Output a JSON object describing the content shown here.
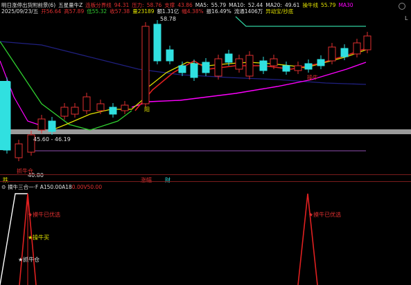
{
  "main_header": {
    "row1": [
      {
        "text": "明日涨停出货附前景(6)",
        "color": "#e0e0e0"
      },
      {
        "text": "五星量牛Z",
        "color": "#e0e0e0"
      },
      {
        "text": "连板分界线",
        "color": "#e03030"
      },
      {
        "text": "94.31",
        "color": "#e03030"
      },
      {
        "text": "压力:",
        "color": "#e03030"
      },
      {
        "text": "58.76",
        "color": "#e03030"
      },
      {
        "text": "支撑",
        "color": "#e03030"
      },
      {
        "text": "43.86",
        "color": "#e03030"
      },
      {
        "text": "MA5:",
        "color": "#e0e0e0"
      },
      {
        "text": "55.79",
        "color": "#e0e0e0"
      },
      {
        "text": "MA10:",
        "color": "#e0e0e0"
      },
      {
        "text": "52.44",
        "color": "#e0e0e0"
      },
      {
        "text": "MA20:",
        "color": "#e0e0e0"
      },
      {
        "text": "49.61",
        "color": "#e0e0e0"
      },
      {
        "text": "操牛线",
        "color": "#e0e000"
      },
      {
        "text": "55.79",
        "color": "#e0e000"
      },
      {
        "text": "MA30",
        "color": "#ff00ff"
      }
    ],
    "row2": [
      {
        "text": "2025/09/23/五",
        "color": "#e0e0e0"
      },
      {
        "text": "开56.64",
        "color": "#e03030"
      },
      {
        "text": "高57.89",
        "color": "#e03030"
      },
      {
        "text": "低55.32",
        "color": "#33cc33"
      },
      {
        "text": "收57.38",
        "color": "#e03030"
      },
      {
        "text": "量23189",
        "color": "#e0e000"
      },
      {
        "text": "额1.31亿",
        "color": "#e0e0e0"
      },
      {
        "text": "幅4.38%",
        "color": "#e03030"
      },
      {
        "text": "振16.49%",
        "color": "#e0e0e0"
      },
      {
        "text": "流通1406万",
        "color": "#e0e0e0"
      },
      {
        "text": "异动宝/抄底",
        "color": "#e0e000"
      }
    ]
  },
  "annotations": {
    "high_label": "58.78",
    "range_label": "45.60 - 46.19",
    "low_label": "40.80",
    "yang_label": "阳",
    "catch_cow": "抓牛仓",
    "cow_badge": "操牛",
    "axis_left": "跌",
    "axis_mid": "涨幅",
    "axis_mid2": "财",
    "window_l": "L"
  },
  "sub_header": {
    "title": "摘牛三合一·F",
    "values": [
      {
        "text": "A15",
        "color": "#e0e0e0"
      },
      {
        "text": "0.00",
        "color": "#e0e0e0"
      },
      {
        "text": "A18",
        "color": "#e0e0e0"
      },
      {
        "text": "0.00",
        "color": "#e03030"
      },
      {
        "text": "V5",
        "color": "#e03030"
      },
      {
        "text": "0.00",
        "color": "#e03030"
      }
    ]
  },
  "sub_labels": {
    "bull1": "★摸牛已优选",
    "bull2": "★操牛买",
    "bull3": "★抓牛仓",
    "bull4": "★摸牛已优选"
  },
  "colors": {
    "up": "#e03030",
    "down": "#30e0e0",
    "ma_red": "#e02020",
    "ma_yellow": "#e0e000",
    "ma_green": "#30d030",
    "ma_purple": "#ff00ff",
    "ma_blue": "#303090",
    "ma_teal": "#30d0a0"
  }
}
